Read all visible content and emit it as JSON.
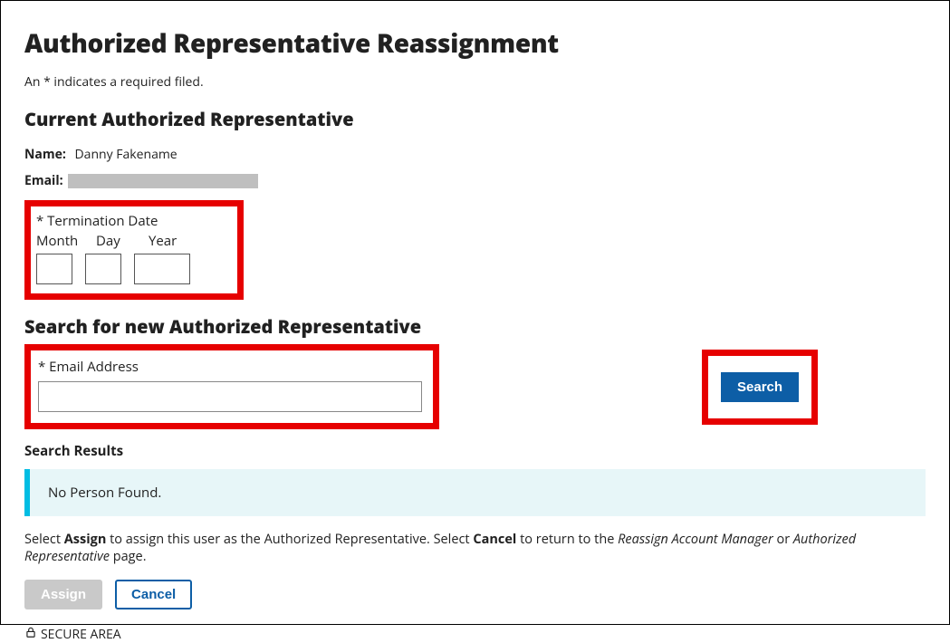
{
  "page_title": "Authorized Representative Reassignment",
  "required_note": "An * indicates a required filed.",
  "current_section_title": "Current Authorized Representative",
  "current": {
    "name_label": "Name:",
    "name_value": "Danny Fakename",
    "email_label": "Email:"
  },
  "termination": {
    "legend": "* Termination Date",
    "month_label": "Month",
    "day_label": "Day",
    "year_label": "Year"
  },
  "search_section_title": "Search for new Authorized Representative",
  "email_field_label": "* Email Address",
  "search_button": "Search",
  "results_heading": "Search Results",
  "results_message": "No Person Found.",
  "instructions": {
    "t1": "Select ",
    "b1": "Assign",
    "t2": " to assign this user as the Authorized Representative. Select ",
    "b2": "Cancel",
    "t3": " to return to the ",
    "i1": "Reassign Account Manager",
    "t4": " or ",
    "i2": "Authorized Representative",
    "t5": " page."
  },
  "buttons": {
    "assign": "Assign",
    "cancel": "Cancel"
  },
  "secure_area": "SECURE AREA"
}
